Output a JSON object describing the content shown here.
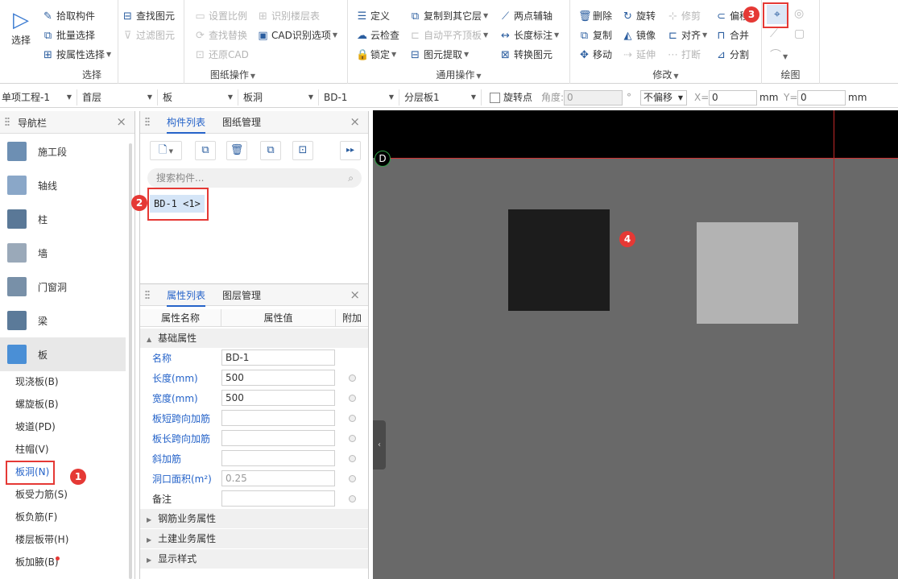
{
  "ribbon": {
    "select": {
      "label": "选择",
      "group_label": "选择",
      "items": [
        "拾取构件",
        "批量选择",
        "按属性选择"
      ]
    },
    "drawing": {
      "group_label": "图纸操作",
      "items": [
        "查找图元",
        "过滤图元",
        "设置比例",
        "识别楼层表",
        "查找替换",
        "CAD识别选项",
        "还原CAD"
      ]
    },
    "common": {
      "group_label": "通用操作",
      "items": [
        "定义",
        "复制到其它层",
        "两点辅轴",
        "云检查",
        "自动平齐顶板",
        "长度标注",
        "锁定",
        "图元提取",
        "转换图元"
      ]
    },
    "modify": {
      "group_label": "修改",
      "items": [
        "删除",
        "旋转",
        "修剪",
        "偏移",
        "复制",
        "镜像",
        "对齐",
        "合并",
        "移动",
        "延伸",
        "打断",
        "分割"
      ]
    },
    "draw": {
      "group_label": "绘图"
    }
  },
  "toolbar": {
    "project": "单项工程-1",
    "floor": "首层",
    "category": "板",
    "type": "板洞",
    "component": "BD-1",
    "layer": "分层板1",
    "rotate_label": "旋转点",
    "angle_label": "角度:",
    "angle_value": "0",
    "degree": "°",
    "offset": "不偏移",
    "x_label": "X=",
    "x_value": "0",
    "y_label": "Y=",
    "y_value": "0",
    "unit": "mm"
  },
  "nav": {
    "title": "导航栏",
    "items": [
      {
        "label": "施工段",
        "color": "#6d8fb3"
      },
      {
        "label": "轴线",
        "color": "#8aa7c8"
      },
      {
        "label": "柱",
        "color": "#5a7897"
      },
      {
        "label": "墙",
        "color": "#9aa9b9"
      },
      {
        "label": "门窗洞",
        "color": "#7890a8"
      },
      {
        "label": "梁",
        "color": "#5b7a99"
      },
      {
        "label": "板",
        "color": "#4a8fd6"
      }
    ],
    "sub_items": [
      "现浇板(B)",
      "螺旋板(B)",
      "坡道(PD)",
      "柱帽(V)",
      "板洞(N)",
      "板受力筋(S)",
      "板负筋(F)",
      "楼层板带(H)",
      "板加腋(B)"
    ]
  },
  "component_panel": {
    "tab_active": "构件列表",
    "tab_other": "图纸管理",
    "search_placeholder": "搜索构件...",
    "component": "BD-1 <1>"
  },
  "property_panel": {
    "tab_active": "属性列表",
    "tab_other": "图层管理",
    "col_name": "属性名称",
    "col_value": "属性值",
    "col_extra": "附加",
    "section_basic": "基础属性",
    "rows": [
      {
        "name": "名称",
        "value": "BD-1"
      },
      {
        "name": "长度(mm)",
        "value": "500"
      },
      {
        "name": "宽度(mm)",
        "value": "500"
      },
      {
        "name": "板短跨向加筋",
        "value": ""
      },
      {
        "name": "板长跨向加筋",
        "value": ""
      },
      {
        "name": "斜加筋",
        "value": ""
      },
      {
        "name": "洞口面积(m²)",
        "value": "0.25"
      },
      {
        "name": "备注",
        "value": ""
      }
    ],
    "sections": [
      "钢筋业务属性",
      "土建业务属性",
      "显示样式"
    ]
  },
  "canvas": {
    "axis_label": "D"
  },
  "badges": [
    "1",
    "2",
    "3",
    "4"
  ],
  "colors": {
    "accent": "#2563c9",
    "badge": "#e53935",
    "canvas_bg": "#696969"
  }
}
